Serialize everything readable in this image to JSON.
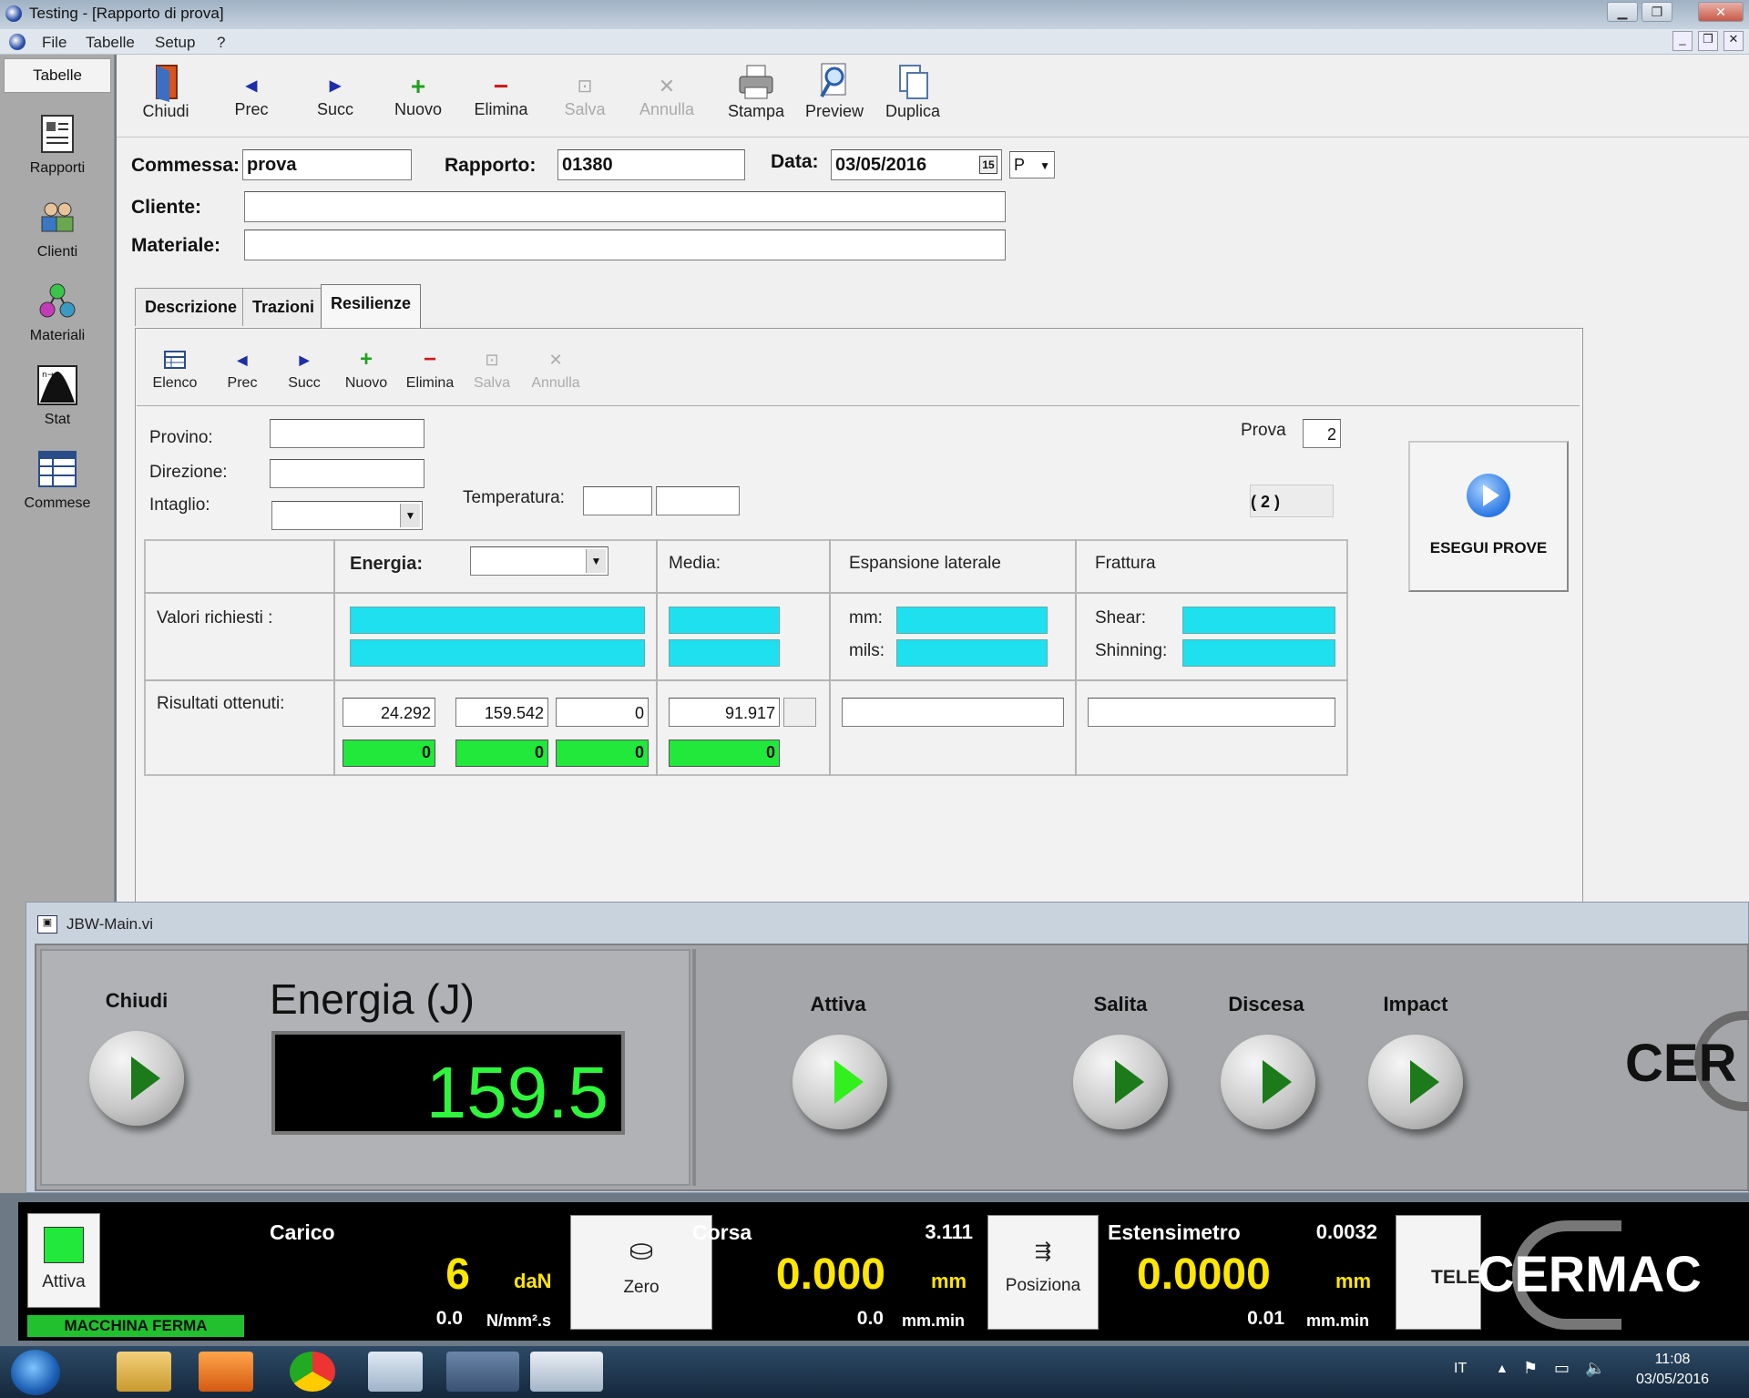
{
  "window": {
    "title": "Testing - [Rapporto di prova]"
  },
  "menu": [
    "File",
    "Tabelle",
    "Setup",
    "?"
  ],
  "sidebar": {
    "header": "Tabelle",
    "items": [
      {
        "label": "Rapporti",
        "icon": "report-icon"
      },
      {
        "label": "Clienti",
        "icon": "clients-icon"
      },
      {
        "label": "Materiali",
        "icon": "materials-icon"
      },
      {
        "label": "Stat",
        "icon": "stat-icon"
      },
      {
        "label": "Commese",
        "icon": "orders-icon"
      }
    ]
  },
  "toolbar": {
    "chiudi": "Chiudi",
    "prec": "Prec",
    "succ": "Succ",
    "nuovo": "Nuovo",
    "elimina": "Elimina",
    "salva": "Salva",
    "annulla": "Annulla",
    "stampa": "Stampa",
    "preview": "Preview",
    "duplica": "Duplica"
  },
  "header": {
    "commessa_label": "Commessa:",
    "commessa_value": "prova",
    "rapporto_label": "Rapporto:",
    "rapporto_value": "01380",
    "data_label": "Data:",
    "data_value": "03/05/2016",
    "data_type": "P",
    "cliente_label": "Cliente:",
    "cliente_value": "",
    "materiale_label": "Materiale:",
    "materiale_value": ""
  },
  "tabs": [
    "Descrizione",
    "Trazioni",
    "Resilienze"
  ],
  "subtoolbar": {
    "elenco": "Elenco",
    "prec": "Prec",
    "succ": "Succ",
    "nuovo": "Nuovo",
    "elimina": "Elimina",
    "salva": "Salva",
    "annulla": "Annulla"
  },
  "specimen": {
    "provino_label": "Provino:",
    "provino_value": "",
    "direzione_label": "Direzione:",
    "direzione_value": "",
    "intaglio_label": "Intaglio:",
    "intaglio_value": "",
    "temperatura_label": "Temperatura:",
    "prova_label": "Prova",
    "prova_value": "2",
    "count_label": "( 2 )",
    "esegui_label": "ESEGUI PROVE"
  },
  "results": {
    "energia_label": "Energia:",
    "media_label": "Media:",
    "espansione_label": "Espansione laterale",
    "frattura_label": "Frattura",
    "valori_label": "Valori richiesti :",
    "mm_label": "mm:",
    "mils_label": "mils:",
    "shear_label": "Shear:",
    "shinning_label": "Shinning:",
    "risultati_label": "Risultati ottenuti:",
    "energy_values": [
      "24.292",
      "159.542",
      "0"
    ],
    "media_value": "91.917",
    "green_values": [
      "0",
      "0",
      "0"
    ],
    "media_green": "0"
  },
  "jbw": {
    "title": "JBW-Main.vi",
    "chiudi": "Chiudi",
    "energia_title": "Energia (J)",
    "energia_value": "159.5",
    "attiva": "Attiva",
    "salita": "Salita",
    "discesa": "Discesa",
    "impact": "Impact",
    "brand": "CER"
  },
  "status": {
    "attiva": "Attiva",
    "machine_state": "MACCHINA FERMA",
    "carico_label": "Carico",
    "carico_value": "6",
    "carico_unit": "daN",
    "carico_rate": "0.0",
    "carico_rate_unit": "N/mm².s",
    "zero": "Zero",
    "corsa_label": "Corsa",
    "corsa_top": "3.111",
    "corsa_value": "0.000",
    "corsa_unit": "mm",
    "corsa_rate": "0.0",
    "corsa_rate_unit": "mm.min",
    "posiziona": "Posiziona",
    "est_label": "Estensimetro",
    "est_top": "0.0032",
    "est_value": "0.0000",
    "est_unit": "mm",
    "est_rate": "0.01",
    "est_rate_unit": "mm.min",
    "tele": "TELE",
    "brand": "CERMAC"
  },
  "taskbar": {
    "lang": "IT",
    "time": "11:08",
    "date": "03/05/2016"
  },
  "colors": {
    "cyan": "#1ee0ee",
    "green": "#22e83b",
    "lcd_green": "#2ff53c",
    "yellow": "#ffe600"
  }
}
